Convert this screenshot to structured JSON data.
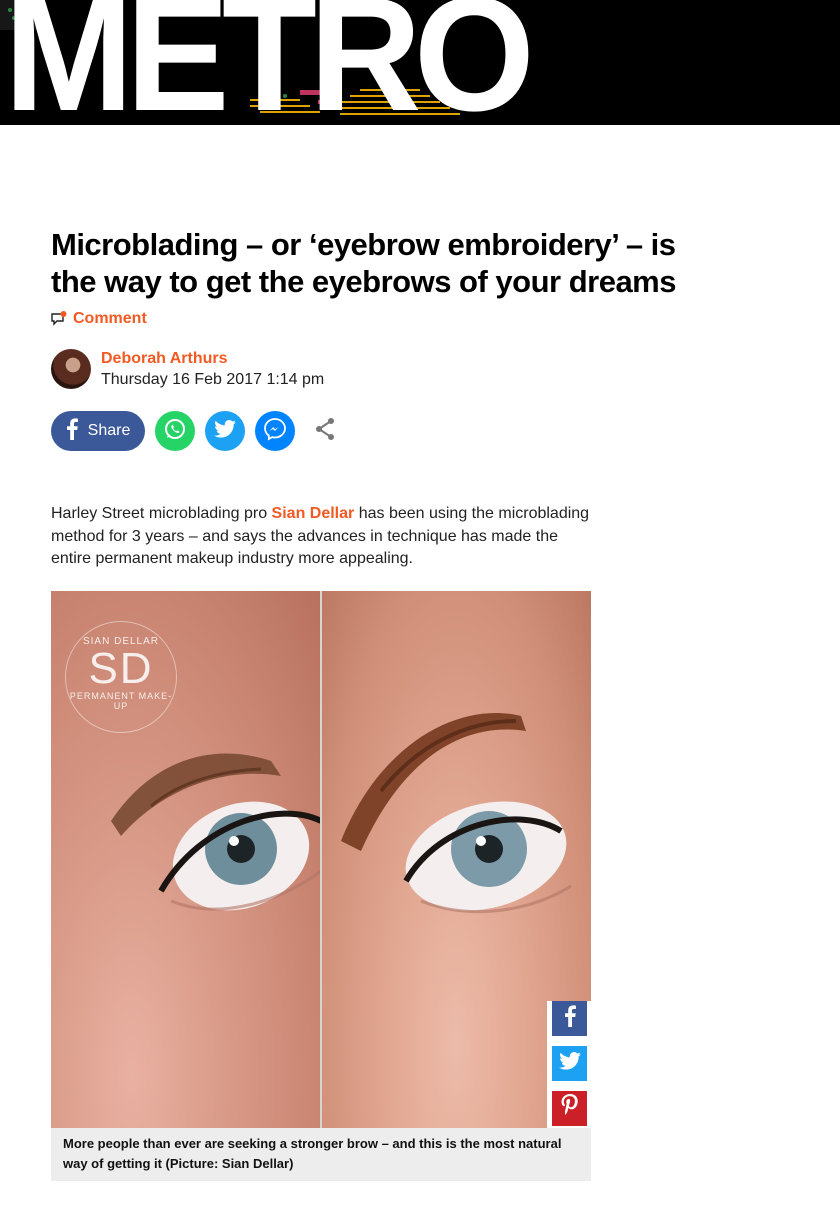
{
  "masthead": {
    "logo_text": "METRO"
  },
  "article": {
    "title": "Microblading – or ‘eyebrow embroidery’ – is the way to get the eyebrows of your dreams",
    "comment_label": "Comment",
    "author": "Deborah Arthurs",
    "date": "Thursday 16 Feb 2017 1:14 pm",
    "share_label": "Share",
    "body": {
      "before": "Harley Street microblading pro ",
      "link": "Sian Dellar",
      "after": " has been using the microblading method for 3 years – and says the advances in technique has made the entire permanent makeup industry more appealing."
    },
    "figure": {
      "caption": "More people than ever are seeking a stronger brow – and this is the most natural way of getting it (Picture: Sian Dellar)",
      "watermark": {
        "top": "SIAN DELLAR",
        "big": "SD",
        "bottom": "PERMANENT MAKE-UP"
      }
    }
  },
  "colors": {
    "accent": "#f15a22",
    "facebook": "#3b5998",
    "whatsapp": "#25d366",
    "twitter": "#1da1f2",
    "messenger": "#0084ff",
    "pinterest": "#cb2027"
  },
  "icons": [
    "comment-icon",
    "facebook-icon",
    "whatsapp-icon",
    "twitter-icon",
    "messenger-icon",
    "share-icon",
    "pinterest-icon"
  ]
}
